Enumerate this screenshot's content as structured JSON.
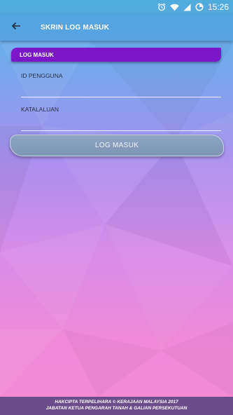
{
  "status_bar": {
    "icons": [
      "alarm-icon",
      "wifi-icon",
      "signal-icon",
      "battery-icon"
    ],
    "time": "15:26"
  },
  "app_bar": {
    "back_icon": "arrow-left-icon",
    "title": "SKRIN LOG MASUK"
  },
  "form": {
    "section_title": "LOG MASUK",
    "user_id": {
      "label": "ID PENGGUNA",
      "value": ""
    },
    "password": {
      "label": "KATALALUAN",
      "value": ""
    },
    "submit_label": "LOG MASUK"
  },
  "footer": {
    "line1": "HAKCIPTA TERPELIHARA © KERAJAAN MALAYSIA 2017",
    "line2": "JABATAN KETUA PENGARAH TANAH & GALIAN PERSEKUTUAN"
  },
  "colors": {
    "accent": "#7b17c9",
    "footer": "#6a4c8a",
    "button": "#8da4c4"
  }
}
